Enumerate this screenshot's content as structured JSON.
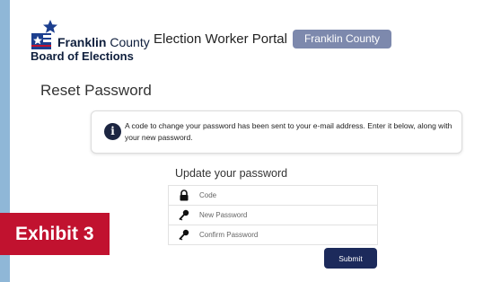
{
  "logo": {
    "line1_bold": "Franklin",
    "line1_rest": " County",
    "line2": "Board of Elections",
    "icon": "flag-star-logo"
  },
  "header": {
    "portal_title": "Election Worker Portal",
    "county_selector": "Franklin County"
  },
  "page": {
    "title": "Reset Password"
  },
  "notice": {
    "icon": "info-icon",
    "text": "A code to change your password has been sent to your e-mail address. Enter it below, along with your new password."
  },
  "form": {
    "title": "Update your password",
    "fields": [
      {
        "placeholder": "Code",
        "icon": "lock-icon"
      },
      {
        "placeholder": "New Password",
        "icon": "key-icon"
      },
      {
        "placeholder": "Confirm Password",
        "icon": "key-icon"
      }
    ],
    "submit_label": "Submit"
  },
  "exhibit_label": "Exhibit 3",
  "colors": {
    "brand_navy": "#1c2a5b",
    "chip": "#7d89ad",
    "exhibit_red": "#c1122f",
    "frame_blue": "#8fb7d7"
  }
}
